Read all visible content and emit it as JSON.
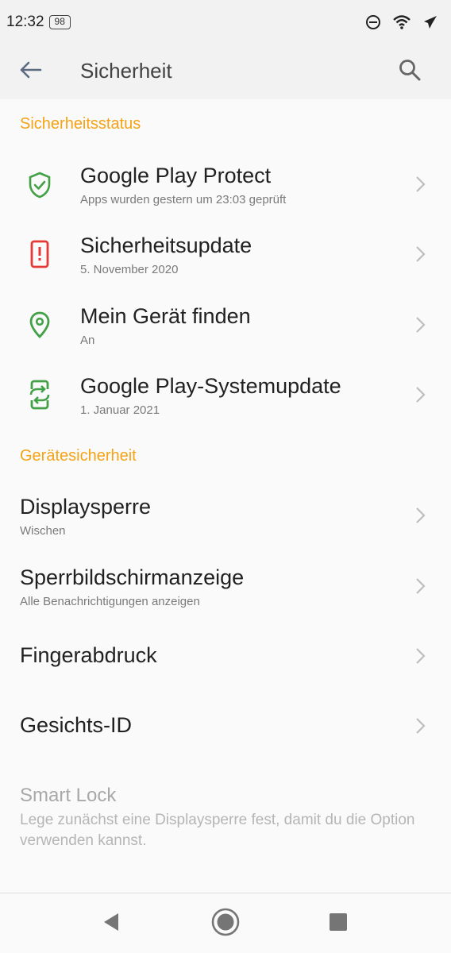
{
  "status_bar": {
    "time": "12:32",
    "battery": "98",
    "icons": [
      "do-not-disturb-icon",
      "wifi-icon",
      "airplane-mode-icon"
    ]
  },
  "app_bar": {
    "title": "Sicherheit",
    "back_icon": "arrow-back-icon",
    "search_icon": "search-icon"
  },
  "sections": {
    "security_status": {
      "header": "Sicherheitsstatus",
      "items": [
        {
          "title": "Google Play Protect",
          "subtitle": "Apps wurden gestern um 23:03 geprüft",
          "icon": "shield-check-icon",
          "icon_color": "#43a047"
        },
        {
          "title": "Sicherheitsupdate",
          "subtitle": "5. November 2020",
          "icon": "phone-alert-icon",
          "icon_color": "#e53935"
        },
        {
          "title": "Mein Gerät finden",
          "subtitle": "An",
          "icon": "location-pin-icon",
          "icon_color": "#43a047"
        },
        {
          "title": "Google Play-Systemupdate",
          "subtitle": "1. Januar 2021",
          "icon": "system-update-icon",
          "icon_color": "#43a047"
        }
      ]
    },
    "device_security": {
      "header": "Gerätesicherheit",
      "items": [
        {
          "title": "Displaysperre",
          "subtitle": "Wischen"
        },
        {
          "title": "Sperrbildschirmanzeige",
          "subtitle": "Alle Benachrichtigungen anzeigen"
        },
        {
          "title": "Fingerabdruck"
        },
        {
          "title": "Gesichts-ID"
        }
      ],
      "smart_lock": {
        "title": "Smart Lock",
        "subtitle": "Lege zunächst eine Displaysperre fest, damit du die Option verwenden kannst."
      }
    }
  },
  "navigation": {
    "back_icon": "nav-back-triangle-icon",
    "home_icon": "nav-home-circle-icon",
    "recents_icon": "nav-recents-square-icon"
  },
  "colors": {
    "accent": "#f5a314",
    "green": "#43a047",
    "red": "#e53935"
  }
}
